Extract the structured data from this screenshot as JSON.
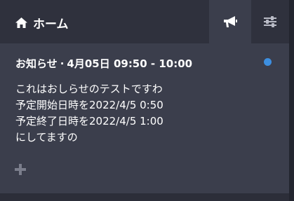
{
  "header": {
    "home_label": "ホーム",
    "home_icon": "home-icon",
    "announce_icon": "megaphone-icon",
    "settings_icon": "sliders-icon"
  },
  "notice": {
    "category": "お知らせ",
    "separator": "·",
    "datetime": "4月05日 09:50 - 10:00",
    "unread": true,
    "unread_color": "#3d8fe0",
    "body_lines": [
      "これはおしらせのテストですわ",
      "予定開始日時を2022/4/5 0:50",
      "予定終了日時を2022/4/5 1:00",
      "にしてますの"
    ]
  },
  "add_icon": "plus-icon",
  "colors": {
    "panel": "#3b3e4c",
    "header": "#2f313d",
    "background": "#23252f"
  }
}
